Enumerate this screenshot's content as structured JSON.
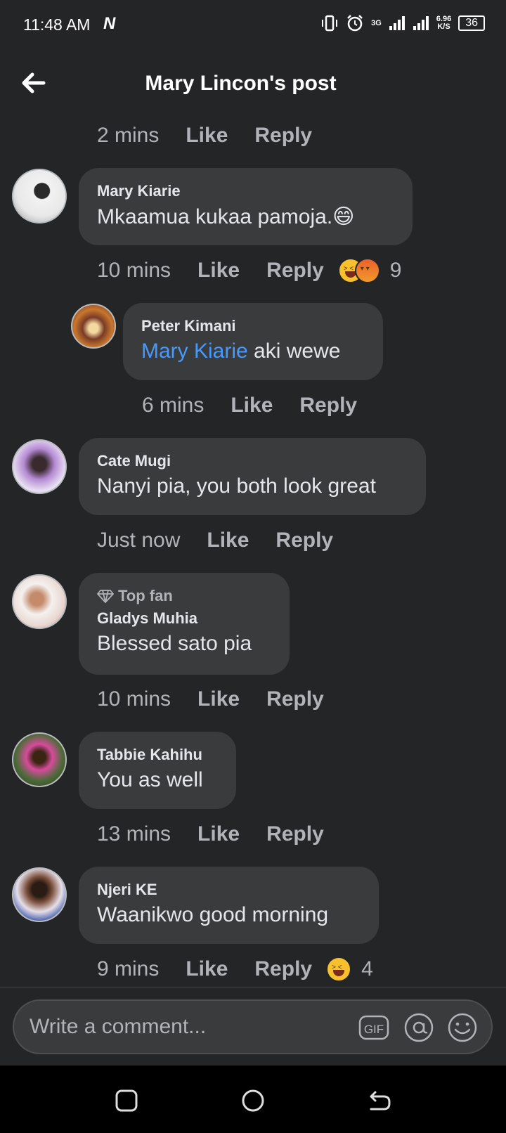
{
  "status_bar": {
    "time": "11:48 AM",
    "network_badge": "N",
    "network_type": "3G",
    "speed_value": "6.96",
    "speed_unit": "K/S",
    "battery": "36"
  },
  "header": {
    "title": "Mary Lincon's post",
    "back_icon": "arrow-left-icon"
  },
  "top_actions": {
    "time": "2 mins",
    "like": "Like",
    "reply": "Reply"
  },
  "comments": [
    {
      "author": "Mary Kiarie",
      "text": "Mkaamua kukaa pamoja.😄",
      "time": "10 mins",
      "like": "Like",
      "reply": "Reply",
      "reaction_count": "9",
      "reactions": [
        "laugh",
        "angry"
      ]
    },
    {
      "author": "Peter Kimani",
      "mention": "Mary Kiarie",
      "text": " aki wewe",
      "time": "6 mins",
      "like": "Like",
      "reply": "Reply"
    },
    {
      "author": "Cate Mugi",
      "text": "Nanyi pia, you both look great",
      "time": "Just now",
      "like": "Like",
      "reply": "Reply"
    },
    {
      "badge": "Top fan",
      "author": "Gladys Muhia",
      "text": "Blessed sato pia",
      "time": "10 mins",
      "like": "Like",
      "reply": "Reply"
    },
    {
      "author": "Tabbie Kahihu",
      "text": "You as well",
      "time": "13 mins",
      "like": "Like",
      "reply": "Reply"
    },
    {
      "author": "Njeri KE",
      "text": "Waanikwo good morning",
      "time": "9 mins",
      "like": "Like",
      "reply": "Reply",
      "reaction_count": "4",
      "reactions": [
        "laugh"
      ]
    }
  ],
  "composer": {
    "placeholder": "Write a comment...",
    "gif_label": "GIF"
  },
  "colors": {
    "background": "#242526",
    "bubble": "#3a3b3c",
    "mention": "#4599ff",
    "secondary_text": "#b0b3b8"
  }
}
